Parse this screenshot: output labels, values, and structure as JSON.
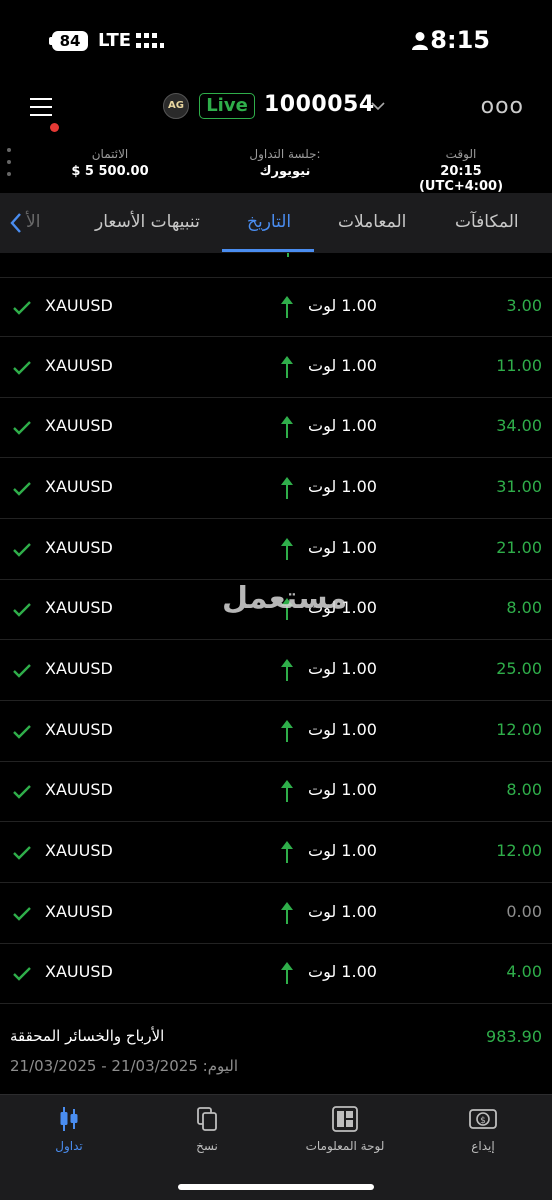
{
  "status_bar": {
    "battery": "84",
    "network": "LTE",
    "time": "8:15"
  },
  "header": {
    "logo_text": "AG",
    "live_label": "Live",
    "account_number": "1000054",
    "more_label": "ooo"
  },
  "info": {
    "credit_label": "الائتمان",
    "credit_value": "$ 5 500.00",
    "session_label": "جلسة التداول:",
    "session_value": "نيويورك",
    "time_label": "الوقت",
    "time_value": "20:15 (UTC+4:00)"
  },
  "tabs": {
    "faded_label": "الأ",
    "items": [
      {
        "label": "تنبيهات الأسعار"
      },
      {
        "label": "التاريخ"
      },
      {
        "label": "المعاملات"
      },
      {
        "label": "المكافآت"
      }
    ],
    "active_index": 1
  },
  "trades": [
    {
      "symbol": "XAUUSD",
      "lots": "1.00 لوت",
      "pnl": "3.00"
    },
    {
      "symbol": "XAUUSD",
      "lots": "1.00 لوت",
      "pnl": "11.00"
    },
    {
      "symbol": "XAUUSD",
      "lots": "1.00 لوت",
      "pnl": "34.00"
    },
    {
      "symbol": "XAUUSD",
      "lots": "1.00 لوت",
      "pnl": "31.00"
    },
    {
      "symbol": "XAUUSD",
      "lots": "1.00 لوت",
      "pnl": "21.00"
    },
    {
      "symbol": "XAUUSD",
      "lots": "1.00 لوت",
      "pnl": "8.00"
    },
    {
      "symbol": "XAUUSD",
      "lots": "1.00 لوت",
      "pnl": "25.00"
    },
    {
      "symbol": "XAUUSD",
      "lots": "1.00 لوت",
      "pnl": "12.00"
    },
    {
      "symbol": "XAUUSD",
      "lots": "1.00 لوت",
      "pnl": "8.00"
    },
    {
      "symbol": "XAUUSD",
      "lots": "1.00 لوت",
      "pnl": "12.00"
    },
    {
      "symbol": "XAUUSD",
      "lots": "1.00 لوت",
      "pnl": "0.00"
    },
    {
      "symbol": "XAUUSD",
      "lots": "1.00 لوت",
      "pnl": "4.00"
    }
  ],
  "summary": {
    "label": "الأرباح والخسائر المحققة",
    "value": "983.90",
    "date_range": "21/03/2025 - 21/03/2025 :اليوم"
  },
  "watermark": "مستعمل",
  "bottom_nav": [
    {
      "label": "تداول",
      "icon": "candlestick-icon"
    },
    {
      "label": "نسخ",
      "icon": "copy-icon"
    },
    {
      "label": "لوحة المعلومات",
      "icon": "dashboard-icon"
    },
    {
      "label": "إيداع",
      "icon": "deposit-icon"
    }
  ],
  "colors": {
    "profit": "#2fae4a",
    "neutral": "#8e8e8e",
    "accent": "#4a8df0",
    "live": "#2fae4a",
    "alert_dot": "#e53935"
  }
}
